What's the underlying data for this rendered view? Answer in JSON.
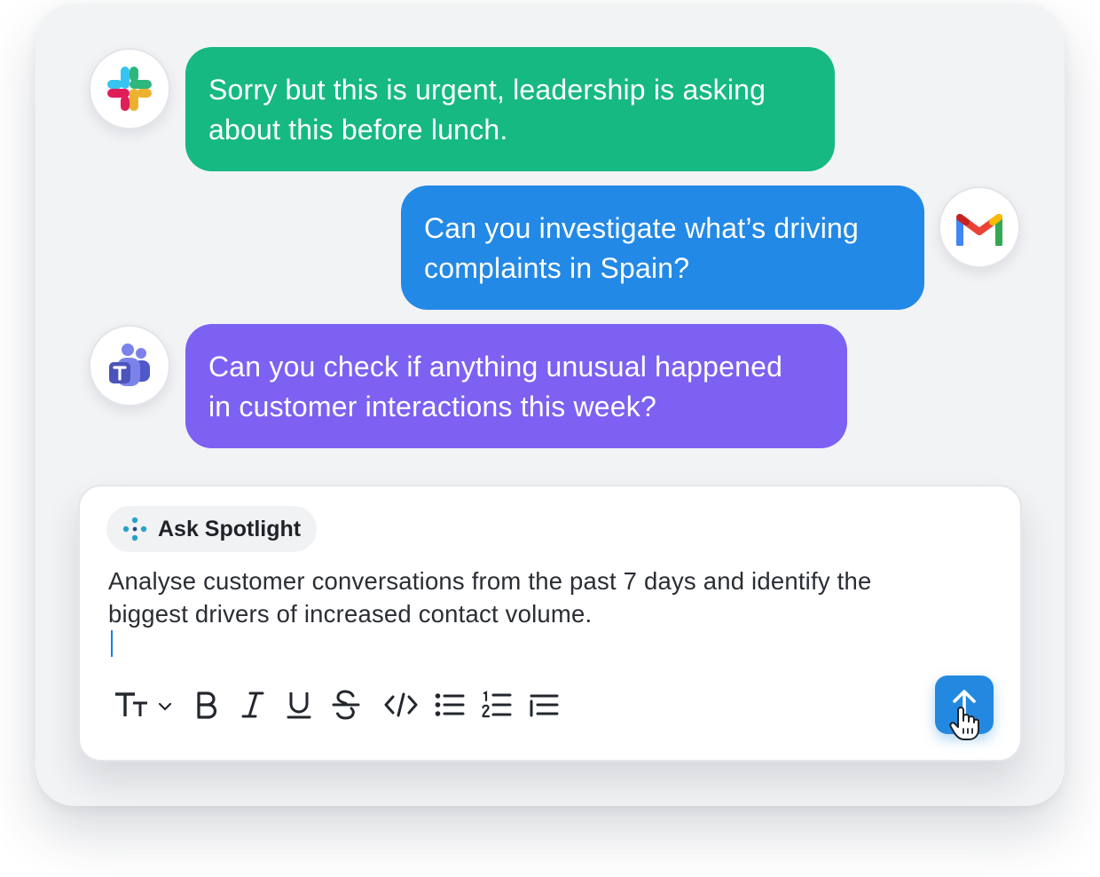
{
  "messages": [
    {
      "source": "slack",
      "lines": [
        "Sorry but this is urgent, leadership is asking",
        "about this before lunch."
      ],
      "color": "#16b982"
    },
    {
      "source": "gmail",
      "lines": [
        "Can you investigate what’s driving",
        "complaints in Spain?"
      ],
      "color": "#2389e6"
    },
    {
      "source": "teams",
      "lines": [
        "Can you check if anything unusual happened",
        "in customer interactions this week?"
      ],
      "color": "#7d61f2"
    }
  ],
  "avatars": {
    "slack": "slack-logo-icon",
    "gmail": "gmail-logo-icon",
    "teams": "teams-logo-icon"
  },
  "composer": {
    "chip_label": "Ask Spotlight",
    "chip_icon": "sparkle-dots-icon",
    "text_lines": [
      "Analyse customer conversations from the past 7 days and identify the",
      "biggest drivers of increased contact volume."
    ],
    "toolbar": [
      "text-size-icon",
      "bold-icon",
      "italic-icon",
      "underline-icon",
      "strikethrough-icon",
      "code-icon",
      "bullet-list-icon",
      "numbered-list-icon",
      "indent-list-icon"
    ],
    "send_icon": "send-arrow-icon",
    "accent": "#2389e0"
  }
}
